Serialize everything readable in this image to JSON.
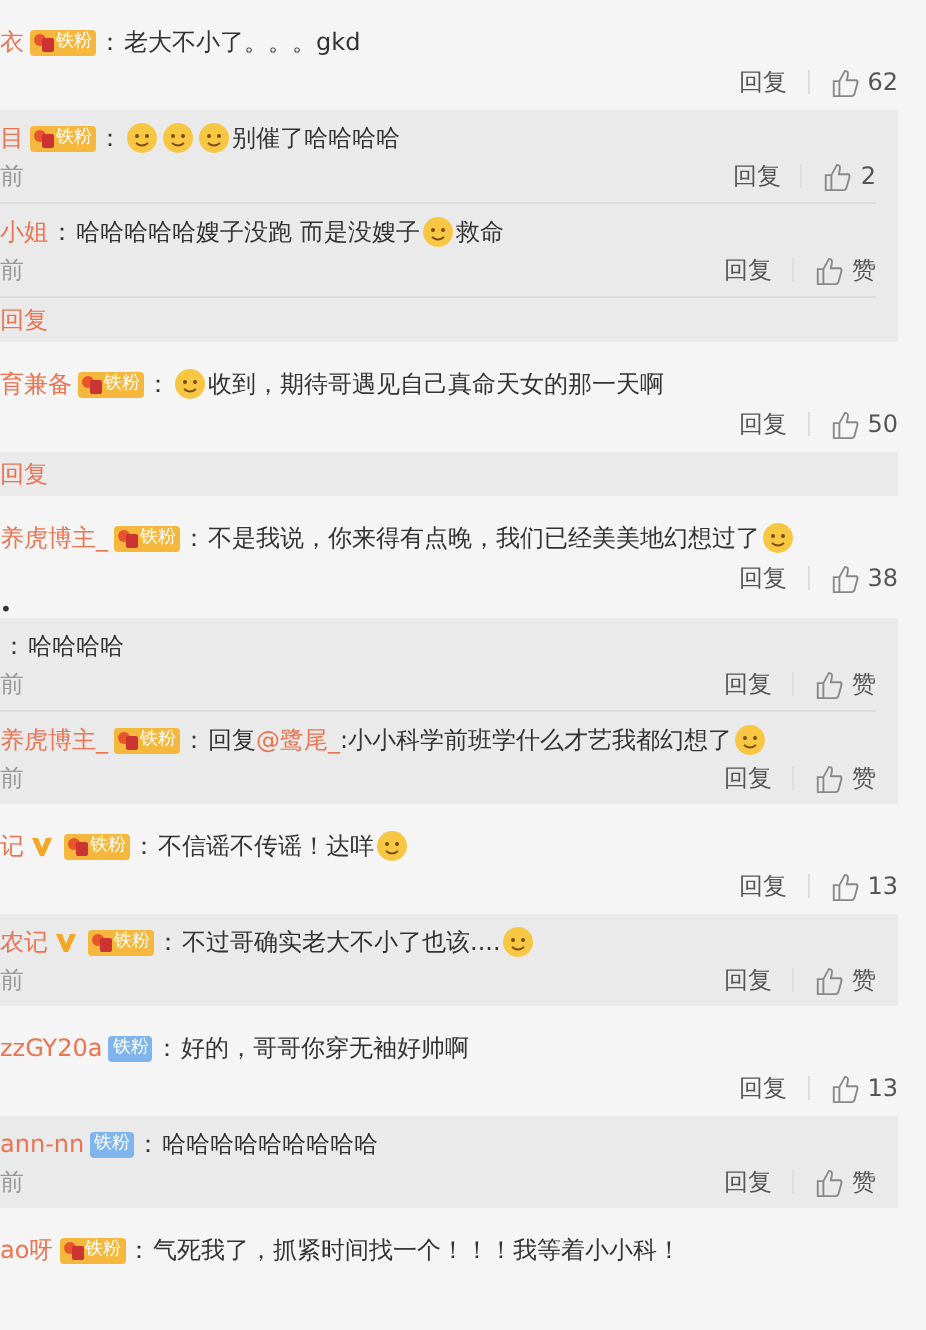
{
  "items": [
    {
      "kind": "comment",
      "name": "衣",
      "badge": {
        "kind": "gold",
        "text": "铁粉"
      },
      "colon": "：",
      "content": [
        {
          "kind": "text",
          "text": "老大不小了。。。gkd"
        }
      ],
      "reply": "回复",
      "likes": "62"
    },
    {
      "kind": "replies",
      "replies": [
        {
          "name": "目",
          "badge": {
            "kind": "gold",
            "text": "铁粉"
          },
          "colon": "：",
          "content": [
            {
              "kind": "emoji"
            },
            {
              "kind": "emoji"
            },
            {
              "kind": "emoji"
            },
            {
              "kind": "text",
              "text": "别催了哈哈哈哈"
            }
          ],
          "time": "前",
          "reply": "回复",
          "likes": "2"
        },
        {
          "name": "小姐",
          "colon": "：",
          "content": [
            {
              "kind": "text",
              "text": "哈哈哈哈哈嫂子没跑 而是没嫂子"
            },
            {
              "kind": "emoji"
            },
            {
              "kind": "text",
              "text": "救命"
            }
          ],
          "time": "前",
          "reply": "回复",
          "likes": "赞"
        }
      ],
      "more": "回复"
    },
    {
      "kind": "comment",
      "name": "育兼备",
      "badge": {
        "kind": "gold",
        "text": "铁粉"
      },
      "colon": "：",
      "content": [
        {
          "kind": "emoji"
        },
        {
          "kind": "text",
          "text": "收到，期待哥遇见自己真命天女的那一天啊"
        }
      ],
      "reply": "回复",
      "likes": "50"
    },
    {
      "kind": "replies",
      "more": "回复"
    },
    {
      "kind": "comment",
      "name": "养虎博主_",
      "badge": {
        "kind": "gold",
        "text": "铁粉"
      },
      "colon": "：",
      "content": [
        {
          "kind": "text",
          "text": "不是我说，你来得有点晚，我们已经美美地幻想过了"
        },
        {
          "kind": "emoji"
        }
      ],
      "reply": "回复",
      "likes": "38"
    },
    {
      "kind": "bullet",
      "text": "•"
    },
    {
      "kind": "replies",
      "replies": [
        {
          "colon": "：",
          "content": [
            {
              "kind": "text",
              "text": "哈哈哈哈"
            }
          ],
          "time": "前",
          "reply": "回复",
          "likes": "赞"
        },
        {
          "name": "养虎博主_",
          "badge": {
            "kind": "gold",
            "text": "铁粉"
          },
          "colon": "：",
          "content": [
            {
              "kind": "text",
              "text": "回复"
            },
            {
              "kind": "link",
              "text": "@鹭尾_"
            },
            {
              "kind": "text",
              "text": ":小小科学前班学什么才艺我都幻想了"
            },
            {
              "kind": "emoji"
            }
          ],
          "time": "前",
          "reply": "回复",
          "likes": "赞"
        }
      ]
    },
    {
      "kind": "comment",
      "name": "记",
      "verified": true,
      "badge": {
        "kind": "gold",
        "text": "铁粉"
      },
      "colon": "：",
      "content": [
        {
          "kind": "text",
          "text": "不信谣不传谣！达咩"
        },
        {
          "kind": "emoji"
        }
      ],
      "reply": "回复",
      "likes": "13"
    },
    {
      "kind": "replies",
      "replies": [
        {
          "name": "农记",
          "verified": true,
          "badge": {
            "kind": "gold",
            "text": "铁粉"
          },
          "colon": "：",
          "content": [
            {
              "kind": "text",
              "text": "不过哥确实老大不小了也该...."
            },
            {
              "kind": "emoji"
            }
          ],
          "time": "前",
          "reply": "回复",
          "likes": "赞"
        }
      ]
    },
    {
      "kind": "comment",
      "name": "zzGY20a",
      "badge": {
        "kind": "blue",
        "text": "铁粉"
      },
      "colon": "：",
      "content": [
        {
          "kind": "text",
          "text": "好的，哥哥你穿无袖好帅啊"
        }
      ],
      "reply": "回复",
      "likes": "13"
    },
    {
      "kind": "replies",
      "replies": [
        {
          "name": "ann-nn",
          "badge": {
            "kind": "blue",
            "text": "铁粉"
          },
          "colon": "：",
          "content": [
            {
              "kind": "text",
              "text": "哈哈哈哈哈哈哈哈哈"
            }
          ],
          "time": "前",
          "reply": "回复",
          "likes": "赞"
        }
      ]
    },
    {
      "kind": "comment",
      "name": "ao呀",
      "badge": {
        "kind": "gold",
        "text": "铁粉"
      },
      "colon": "：",
      "content": [
        {
          "kind": "text",
          "text": "气死我了，抓紧时间找一个！！！我等着小小科！"
        }
      ]
    }
  ]
}
